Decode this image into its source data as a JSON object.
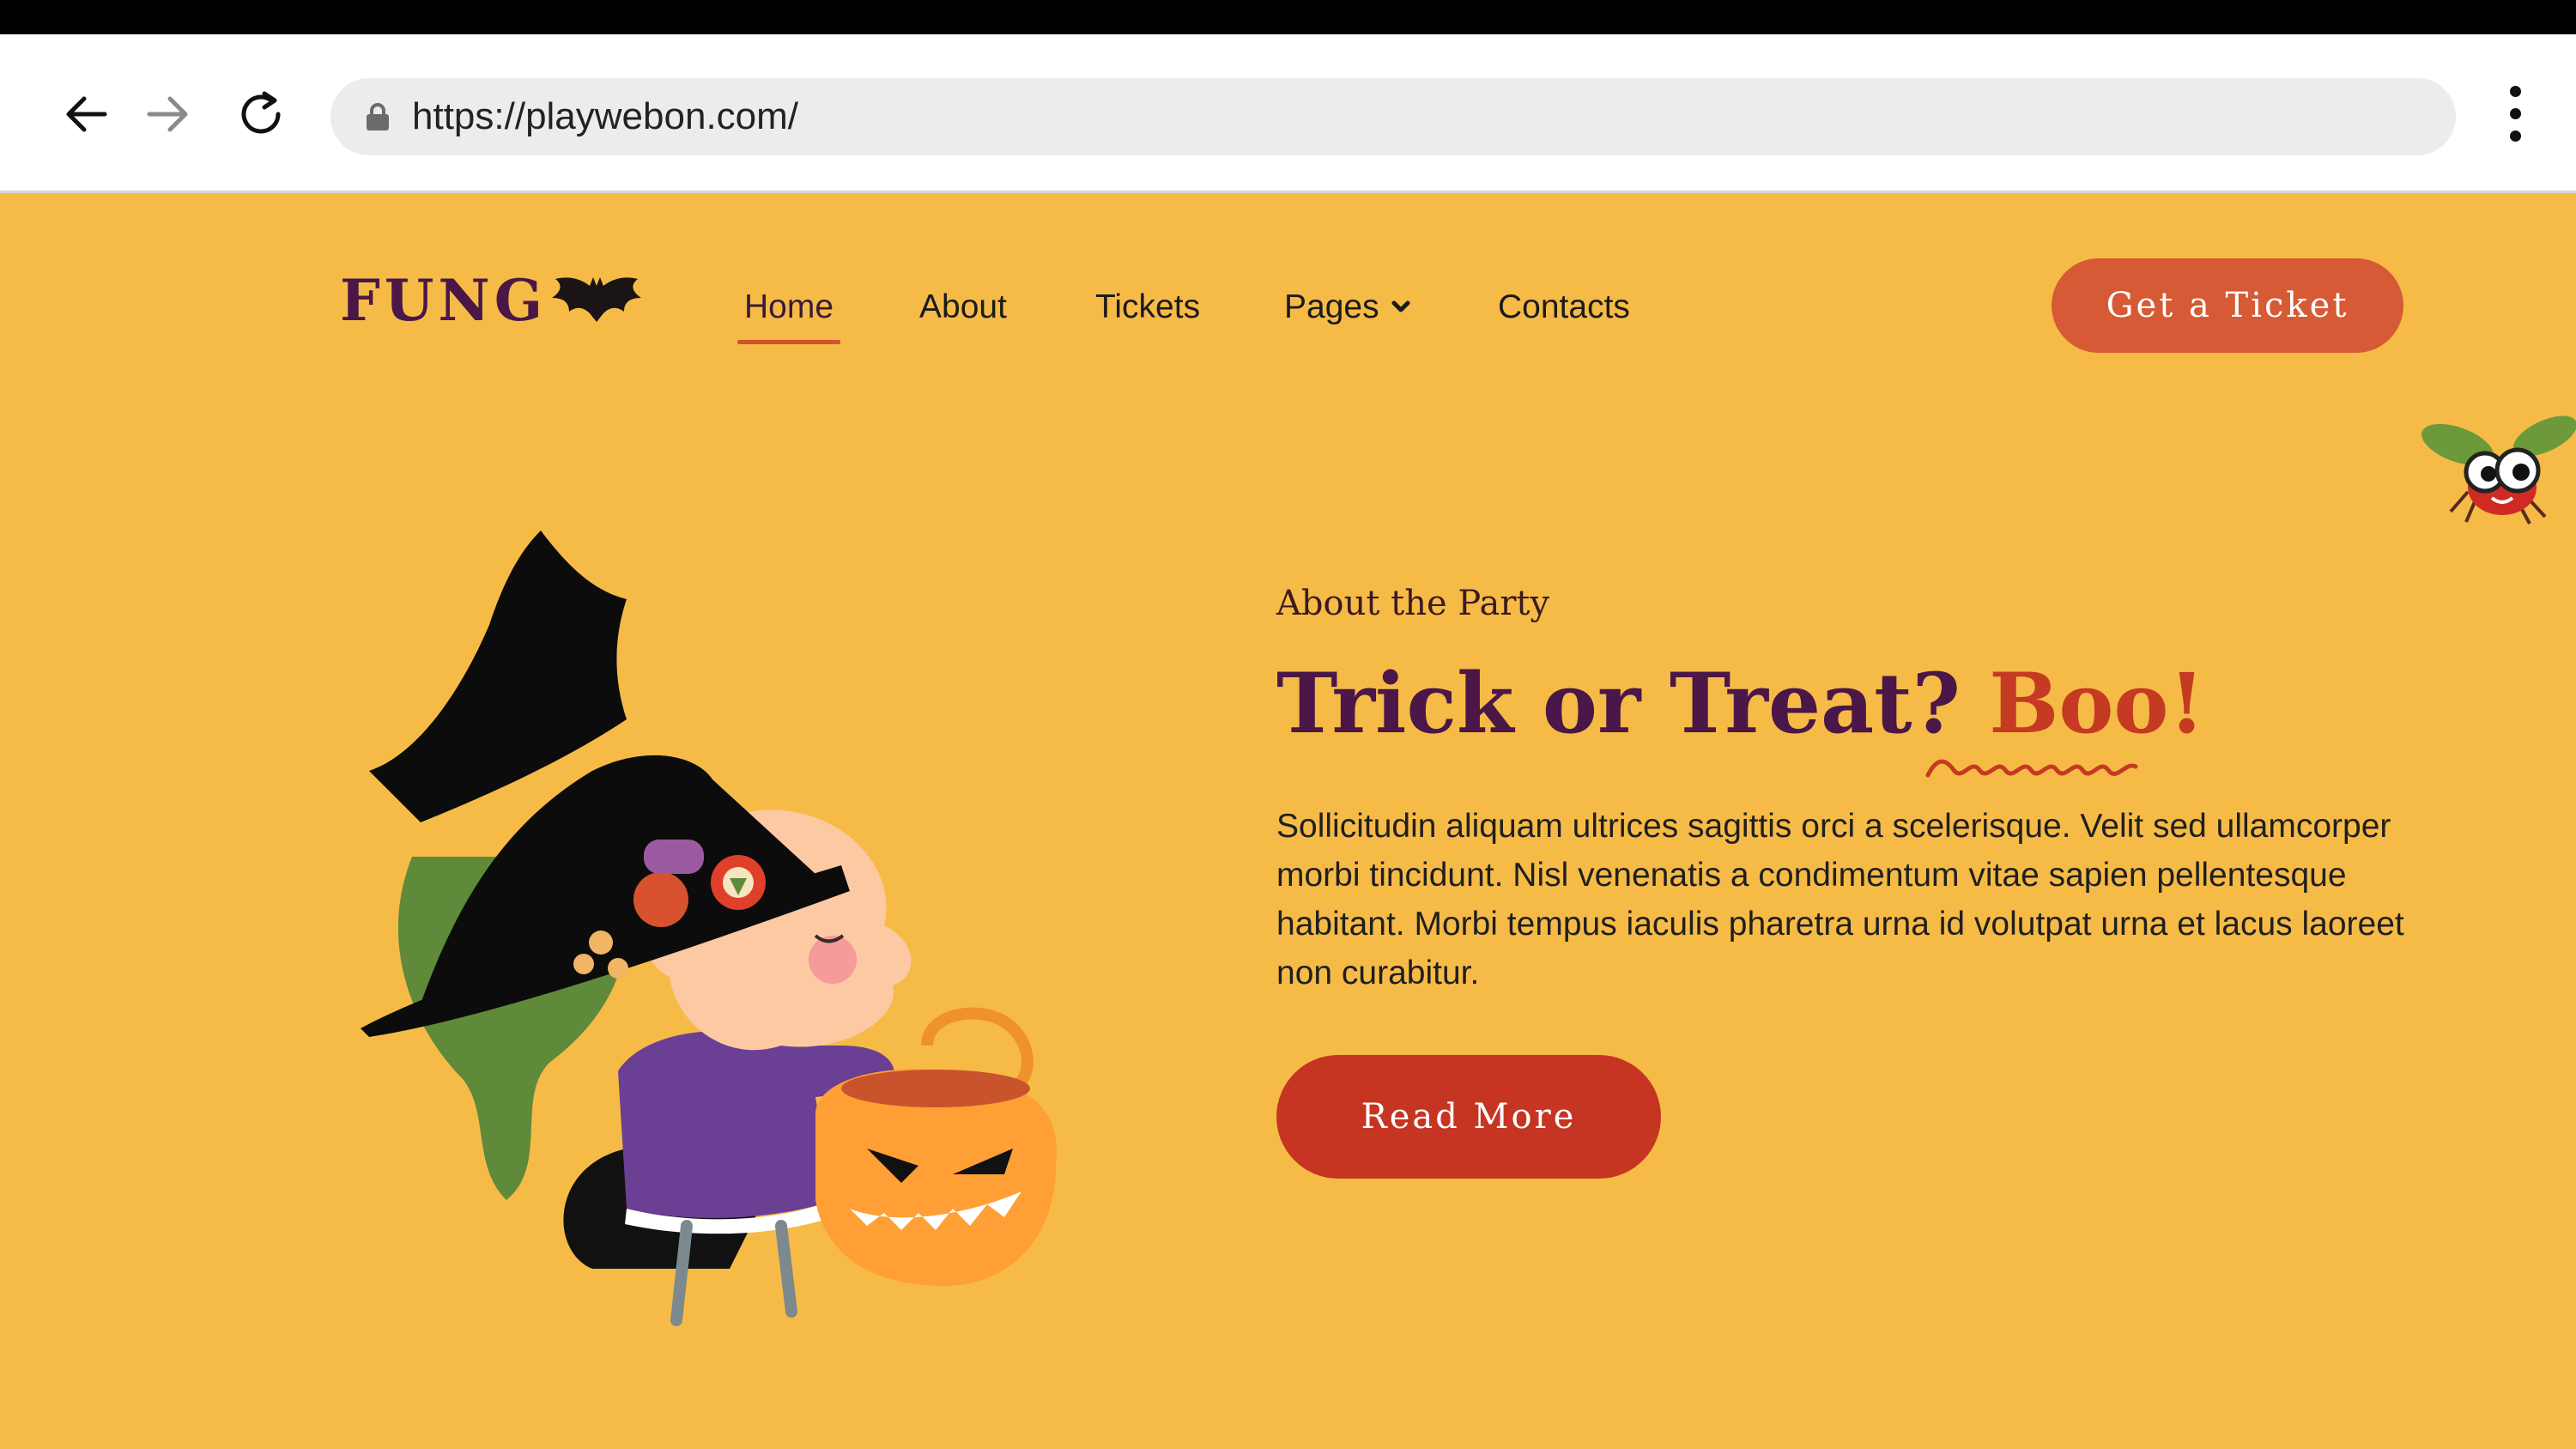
{
  "browser": {
    "url": "https://playwebon.com/"
  },
  "site": {
    "logo_text": "FUNG",
    "nav": [
      {
        "label": "Home"
      },
      {
        "label": "About"
      },
      {
        "label": "Tickets"
      },
      {
        "label": "Pages"
      },
      {
        "label": "Contacts"
      }
    ],
    "cta_label": "Get a Ticket"
  },
  "hero": {
    "eyebrow": "About the Party",
    "headline_main": "Trick or Treat?",
    "headline_accent": "Boo!",
    "body": "Sollicitudin aliquam ultrices sagittis orci a scelerisque. Velit sed ullamcorper morbi tincidunt. Nisl venenatis a condimentum vitae sapien pellentesque habitant. Morbi tempus iaculis pharetra urna id volutpat urna et lacus laoreet non curabitur.",
    "button_label": "Read More"
  },
  "colors": {
    "page_bg": "#f6bb47",
    "brand_purple": "#4a1748",
    "cta_orange": "#d65a35",
    "accent_red": "#c53521"
  },
  "icons": [
    "back-arrow-icon",
    "forward-arrow-icon",
    "reload-icon",
    "lock-icon",
    "kebab-menu-icon",
    "bat-icon",
    "chevron-down-icon"
  ]
}
